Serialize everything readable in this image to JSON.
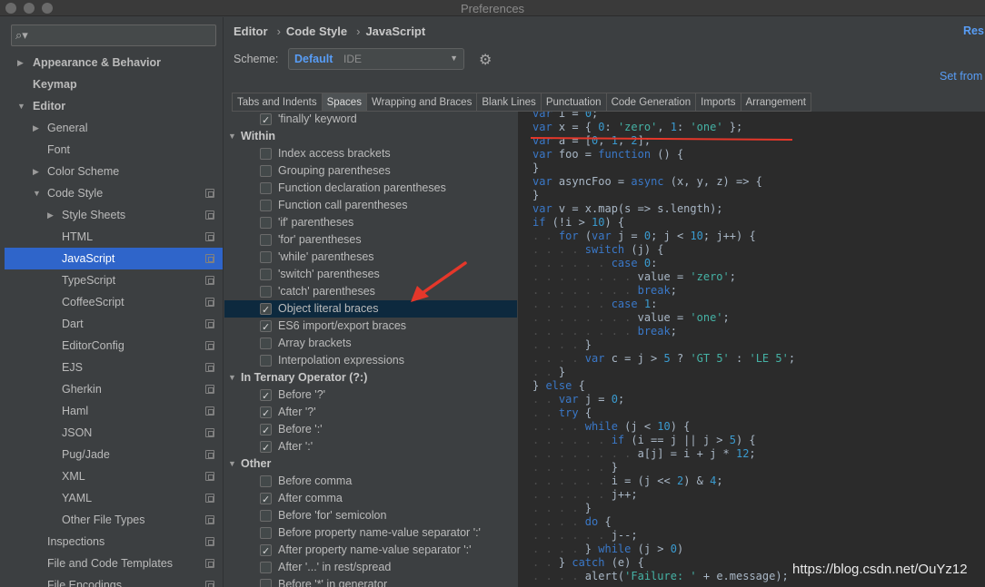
{
  "window": {
    "title": "Preferences"
  },
  "search": {
    "placeholder": ""
  },
  "sidebar": {
    "items": [
      {
        "label": "Appearance & Behavior",
        "bold": true
      },
      {
        "label": "Keymap",
        "bold": true
      },
      {
        "label": "Editor",
        "bold": true
      },
      {
        "label": "General"
      },
      {
        "label": "Font"
      },
      {
        "label": "Color Scheme"
      },
      {
        "label": "Code Style"
      },
      {
        "label": "Style Sheets"
      },
      {
        "label": "HTML"
      },
      {
        "label": "JavaScript",
        "selected": true
      },
      {
        "label": "TypeScript"
      },
      {
        "label": "CoffeeScript"
      },
      {
        "label": "Dart"
      },
      {
        "label": "EditorConfig"
      },
      {
        "label": "EJS"
      },
      {
        "label": "Gherkin"
      },
      {
        "label": "Haml"
      },
      {
        "label": "JSON"
      },
      {
        "label": "Pug/Jade"
      },
      {
        "label": "XML"
      },
      {
        "label": "YAML"
      },
      {
        "label": "Other File Types"
      },
      {
        "label": "Inspections"
      },
      {
        "label": "File and Code Templates"
      },
      {
        "label": "File Encodings"
      }
    ]
  },
  "breadcrumb": {
    "part1": "Editor",
    "part2": "Code Style",
    "part3": "JavaScript",
    "separator": "›"
  },
  "header": {
    "reset_label": "Res",
    "set_from_label": "Set from"
  },
  "scheme": {
    "label": "Scheme:",
    "value": "Default",
    "qualifier": "IDE"
  },
  "tabs": [
    {
      "label": "Tabs and Indents"
    },
    {
      "label": "Spaces",
      "active": true
    },
    {
      "label": "Wrapping and Braces"
    },
    {
      "label": "Blank Lines"
    },
    {
      "label": "Punctuation"
    },
    {
      "label": "Code Generation"
    },
    {
      "label": "Imports"
    },
    {
      "label": "Arrangement"
    }
  ],
  "options": {
    "finally_keyword": {
      "label": "'finally' keyword",
      "checked": true
    },
    "within": {
      "title": "Within",
      "items": [
        {
          "label": "Index access brackets",
          "checked": false
        },
        {
          "label": "Grouping parentheses",
          "checked": false
        },
        {
          "label": "Function declaration parentheses",
          "checked": false
        },
        {
          "label": "Function call parentheses",
          "checked": false
        },
        {
          "label": "'if' parentheses",
          "checked": false
        },
        {
          "label": "'for' parentheses",
          "checked": false
        },
        {
          "label": "'while' parentheses",
          "checked": false
        },
        {
          "label": "'switch' parentheses",
          "checked": false
        },
        {
          "label": "'catch' parentheses",
          "checked": false
        },
        {
          "label": "Object literal braces",
          "checked": true,
          "highlighted": true
        },
        {
          "label": "ES6 import/export braces",
          "checked": true
        },
        {
          "label": "Array brackets",
          "checked": false
        },
        {
          "label": "Interpolation expressions",
          "checked": false
        }
      ]
    },
    "ternary": {
      "title": "In Ternary Operator (?:)",
      "items": [
        {
          "label": "Before '?'",
          "checked": true
        },
        {
          "label": "After '?'",
          "checked": true
        },
        {
          "label": "Before ':'",
          "checked": true
        },
        {
          "label": "After ':'",
          "checked": true
        }
      ]
    },
    "other": {
      "title": "Other",
      "items": [
        {
          "label": "Before comma",
          "checked": false
        },
        {
          "label": "After comma",
          "checked": true
        },
        {
          "label": "Before 'for' semicolon",
          "checked": false
        },
        {
          "label": "Before property name-value separator ':'",
          "checked": false
        },
        {
          "label": "After property name-value separator ':'",
          "checked": true
        },
        {
          "label": "After '...' in rest/spread",
          "checked": false
        },
        {
          "label": "Before '*' in generator",
          "checked": false
        }
      ]
    }
  },
  "code": {
    "lines": [
      "var i = 0;",
      "var x = { 0: 'zero', 1: 'one' };",
      "var a = [0, 1, 2];",
      "var foo = function () {",
      "}",
      "var asyncFoo = async (x, y, z) => {",
      "}",
      "var v = x.map(s => s.length);",
      "if (!i > 10) {",
      "    for (var j = 0; j < 10; j++) {",
      "        switch (j) {",
      "            case 0:",
      "                value = 'zero';",
      "                break;",
      "            case 1:",
      "                value = 'one';",
      "                break;",
      "        }",
      "        var c = j > 5 ? 'GT 5' : 'LE 5';",
      "    }",
      "} else {",
      "    var j = 0;",
      "    try {",
      "        while (j < 10) {",
      "            if (i == j || j > 5) {",
      "                a[j] = i + j * 12;",
      "            }",
      "            i = (j << 2) & 4;",
      "            j++;",
      "        }",
      "        do {",
      "            j--;",
      "        } while (j > 0)",
      "    } catch (e) {",
      "        alert('Failure: ' + e.message);"
    ]
  },
  "colors": {
    "selection": "#2f65ca",
    "highlight_row": "#0d293e",
    "link": "#589df6",
    "annotation_red": "#e5372a",
    "code_bg": "#2b2b2b"
  },
  "watermark": {
    "text": "https://blog.csdn.net/OuYz12"
  }
}
